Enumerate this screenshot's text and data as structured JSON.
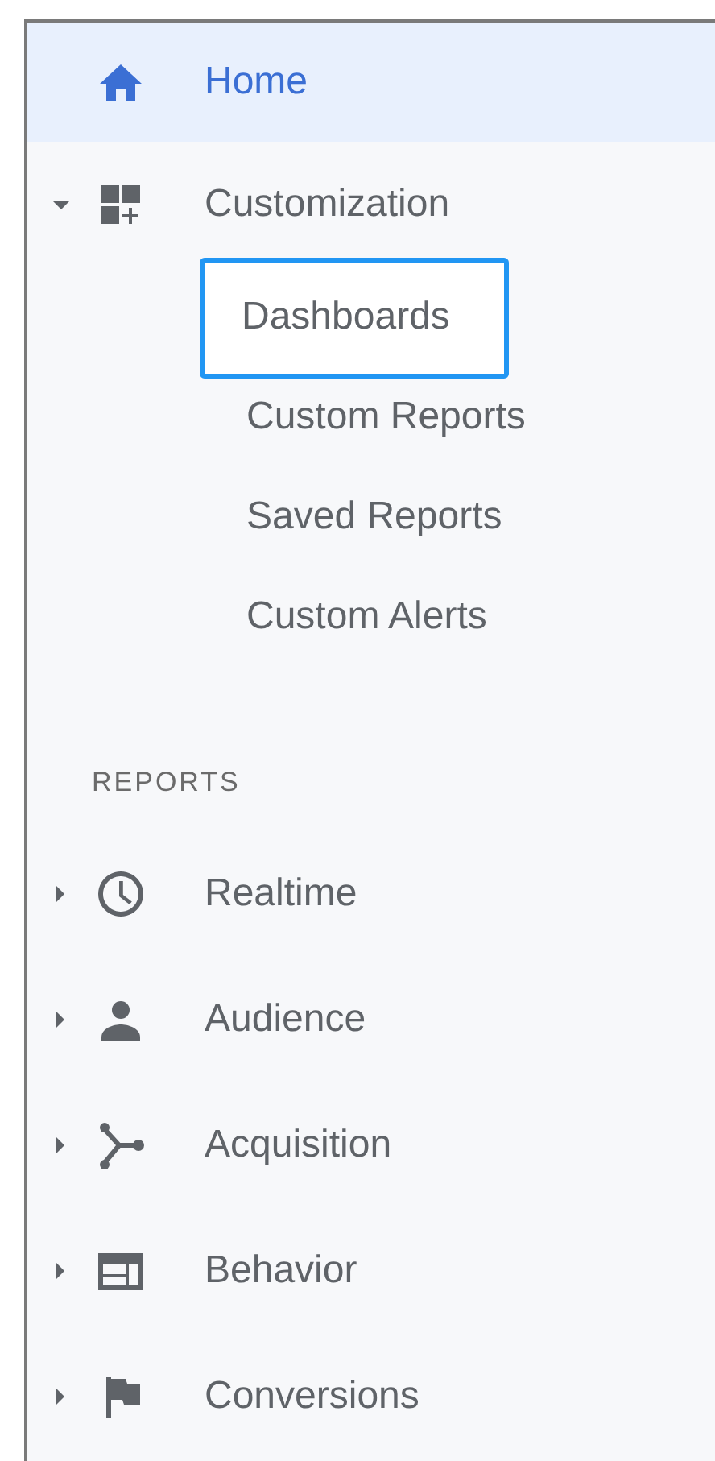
{
  "home": {
    "label": "Home",
    "selected": true
  },
  "customization": {
    "label": "Customization",
    "expanded": true,
    "children": [
      {
        "label": "Dashboards",
        "highlighted": true
      },
      {
        "label": "Custom Reports",
        "highlighted": false
      },
      {
        "label": "Saved Reports",
        "highlighted": false
      },
      {
        "label": "Custom Alerts",
        "highlighted": false
      }
    ]
  },
  "section_label": "REPORTS",
  "reports": [
    {
      "label": "Realtime",
      "expanded": false
    },
    {
      "label": "Audience",
      "expanded": false
    },
    {
      "label": "Acquisition",
      "expanded": false
    },
    {
      "label": "Behavior",
      "expanded": false
    },
    {
      "label": "Conversions",
      "expanded": false
    }
  ]
}
